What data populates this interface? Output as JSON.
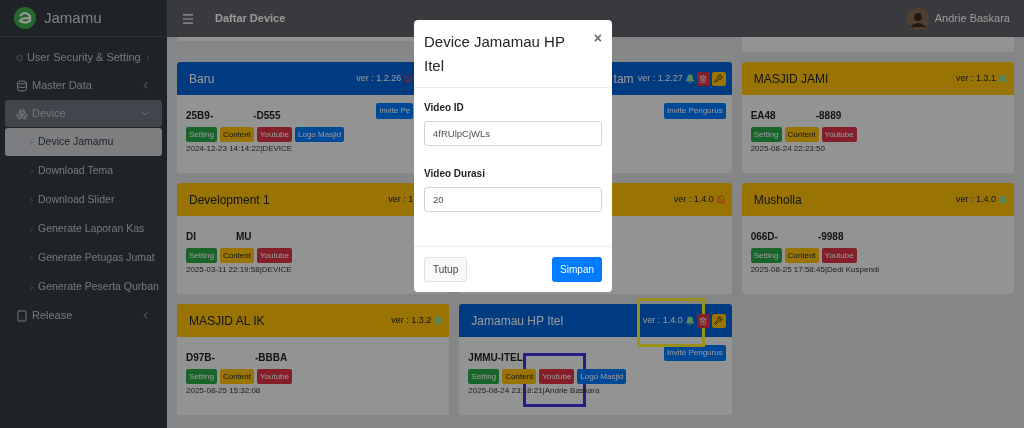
{
  "brand": {
    "name": "Jamamu"
  },
  "sidebar": {
    "items": [
      {
        "label": "User Security & Setting",
        "expanded": false,
        "selected": false
      },
      {
        "label": "Master Data",
        "expanded": false,
        "selected": false
      },
      {
        "label": "Device",
        "expanded": true,
        "selected": true,
        "children": [
          {
            "label": "Device Jamamu",
            "selected": true
          },
          {
            "label": "Download Tema",
            "selected": false
          },
          {
            "label": "Download Slider",
            "selected": false
          },
          {
            "label": "Generate Laporan Kas",
            "selected": false
          },
          {
            "label": "Generate Petugas Jumat",
            "selected": false
          },
          {
            "label": "Generate Peserta Qurban",
            "selected": false
          }
        ]
      },
      {
        "label": "Release",
        "expanded": false,
        "selected": false
      }
    ]
  },
  "header": {
    "title": "Daftar Device",
    "user": "Andrie Baskara"
  },
  "partial_cards": [
    {
      "kind": "stub"
    },
    {
      "kind": "hidden"
    },
    {
      "kind": "stub"
    }
  ],
  "cards": [
    {
      "kind": "primary",
      "title": "Baru",
      "version": "ver : 1.2.26",
      "notifications": false,
      "actions": false,
      "cut_left": false,
      "cut_right": true,
      "code": [
        "25B9-",
        "-D555"
      ],
      "invite": "Invite Pe",
      "badges": [
        {
          "kind": "setting",
          "label": "Setting"
        },
        {
          "kind": "content",
          "label": "Content"
        },
        {
          "kind": "youtube",
          "label": "Youtube"
        },
        {
          "kind": "logo",
          "label": "Logo Masjid"
        }
      ],
      "footer": "2024-12-23 14:14:22|DEVICE"
    },
    {
      "kind": "primary",
      "title": "tam",
      "version": "ver : 1.2.27",
      "notifications": true,
      "actions": true,
      "cut_left": true,
      "cut_right": false,
      "invite": "Invite Pengurus"
    },
    {
      "kind": "warning",
      "title": "MASJID JAMI",
      "version": "ver : 1.3.1",
      "notifications": true,
      "actions": false,
      "cut_left": false,
      "cut_right": false,
      "code": [
        "EA48",
        "-8889"
      ],
      "badges": [
        {
          "kind": "setting",
          "label": "Setting"
        },
        {
          "kind": "content",
          "label": "Content"
        },
        {
          "kind": "youtube",
          "label": "Youtube"
        }
      ],
      "footer": "2025-08-24 22:23:50"
    },
    {
      "kind": "warning",
      "title": "Development 1",
      "version": "ver : 1",
      "actions": false,
      "cut_left": false,
      "cut_right": true,
      "code": [
        "DI",
        "MU"
      ],
      "badges": [
        {
          "kind": "setting",
          "label": "Setting"
        },
        {
          "kind": "content",
          "label": "Content"
        },
        {
          "kind": "youtube",
          "label": "Youtube"
        }
      ],
      "footer": "2025-03-11 22:19:58|DEVICE"
    },
    {
      "kind": "warning",
      "version": "ver : 1.4.0",
      "notifications": false,
      "actions": false
    },
    {
      "kind": "warning",
      "title": "Musholla",
      "version": "ver : 1.4.0",
      "notifications": true,
      "actions": false,
      "cut_left": false,
      "cut_right": false,
      "code": [
        "066D-",
        "-9988"
      ],
      "badges": [
        {
          "kind": "setting",
          "label": "Setting"
        },
        {
          "kind": "content",
          "label": "Content"
        },
        {
          "kind": "youtube",
          "label": "Youtube"
        }
      ],
      "footer": "2025-08-25 17:58:45|Dedi Kuspendi"
    },
    {
      "kind": "warning",
      "title": "MASJID AL IK",
      "version": "ver : 1.3.2",
      "notifications": true,
      "actions": false,
      "cut_left": false,
      "cut_right": false,
      "code": [
        "D97B-",
        "-BBBA"
      ],
      "badges": [
        {
          "kind": "setting",
          "label": "Setting"
        },
        {
          "kind": "content",
          "label": "Content"
        },
        {
          "kind": "youtube",
          "label": "Youtube"
        }
      ],
      "footer": "2025-08-25 15:32:08"
    },
    {
      "kind": "primary",
      "title": "Jamamau HP Itel",
      "version": "ver : 1.4.0",
      "notifications": true,
      "actions": true,
      "cut_left": false,
      "cut_right": false,
      "code": [
        "JMMU-ITEL"
      ],
      "invite": "Invite Pengurus",
      "badges": [
        {
          "kind": "setting",
          "label": "Setting"
        },
        {
          "kind": "content",
          "label": "Content"
        },
        {
          "kind": "youtube",
          "label": "Youtube"
        },
        {
          "kind": "logo",
          "label": "Logo Masjid"
        }
      ],
      "footer": "2025-08-24 23:18:21|Andrie Baskara"
    }
  ],
  "dialog": {
    "title": "Device Jamamau HP Itel",
    "close": "×",
    "fields": [
      {
        "label": "Video ID",
        "value": "4fRUlpCjWLs"
      },
      {
        "label": "Video Durasi",
        "value": "20"
      }
    ],
    "buttons": [
      {
        "kind": "secondary",
        "label": "Tutup"
      },
      {
        "kind": "primary",
        "label": "Simpan"
      }
    ]
  },
  "highlight_frames": [
    {
      "kind": "primary"
    },
    {
      "kind": "secondary"
    }
  ]
}
